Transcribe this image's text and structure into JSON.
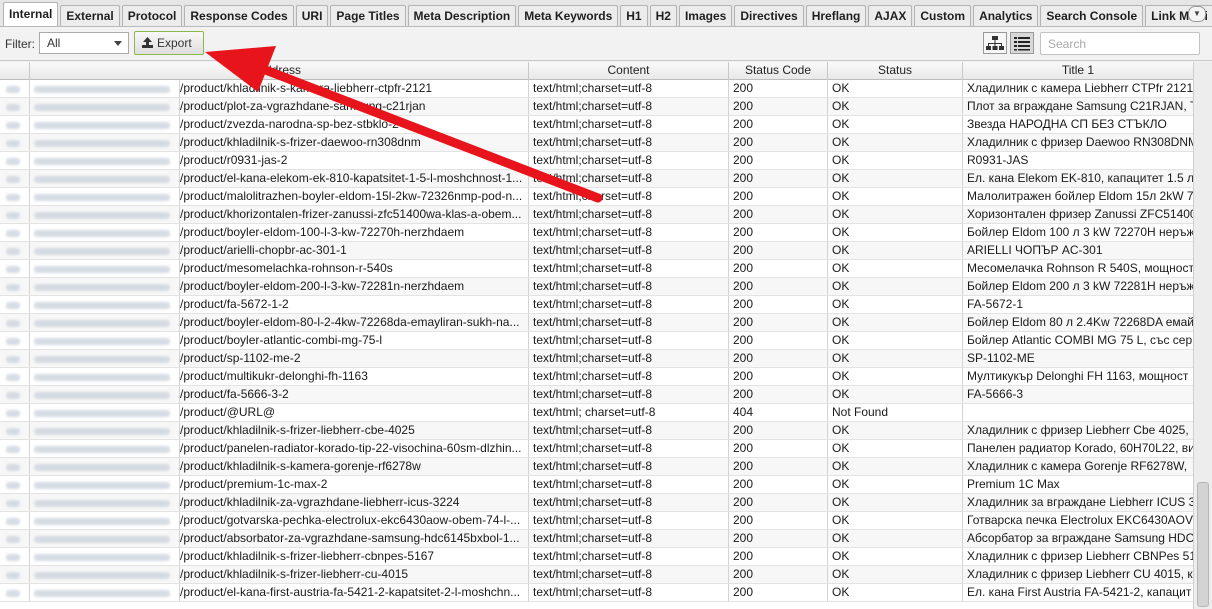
{
  "tabs": [
    {
      "label": "Internal",
      "active": true
    },
    {
      "label": "External"
    },
    {
      "label": "Protocol"
    },
    {
      "label": "Response Codes"
    },
    {
      "label": "URI"
    },
    {
      "label": "Page Titles"
    },
    {
      "label": "Meta Description"
    },
    {
      "label": "Meta Keywords"
    },
    {
      "label": "H1"
    },
    {
      "label": "H2"
    },
    {
      "label": "Images"
    },
    {
      "label": "Directives"
    },
    {
      "label": "Hreflang"
    },
    {
      "label": "AJAX"
    },
    {
      "label": "Custom"
    },
    {
      "label": "Analytics"
    },
    {
      "label": "Search Console"
    },
    {
      "label": "Link Metri"
    }
  ],
  "toolbar": {
    "filter_label": "Filter:",
    "filter_value": "All",
    "export_label": "Export",
    "search_placeholder": "Search"
  },
  "table": {
    "columns": {
      "address": "Address",
      "content": "Content",
      "status_code": "Status Code",
      "status": "Status",
      "title": "Title 1"
    },
    "rows": [
      {
        "address": "/product/khladilnik-s-kamera-liebherr-ctpfr-2121",
        "content": "text/html;charset=utf-8",
        "code": "200",
        "status": "OK",
        "title": "Хладилник с камера Liebherr CTPfr 2121"
      },
      {
        "address": "/product/plot-za-vgrazhdane-samsung-c21rjan",
        "content": "text/html;charset=utf-8",
        "code": "200",
        "status": "OK",
        "title": "Плот за вграждане Samsung C21RJAN, Т"
      },
      {
        "address": "/product/zvezda-narodna-sp-bez-stbklo-2",
        "content": "text/html;charset=utf-8",
        "code": "200",
        "status": "OK",
        "title": "Звезда НАРОДНА СП БЕЗ СТЪКЛО"
      },
      {
        "address": "/product/khladilnik-s-frizer-daewoo-rn308dnm",
        "content": "text/html;charset=utf-8",
        "code": "200",
        "status": "OK",
        "title": "Хладилник с фризер Daewoo RN308DNM"
      },
      {
        "address": "/product/r0931-jas-2",
        "content": "text/html;charset=utf-8",
        "code": "200",
        "status": "OK",
        "title": "R0931-JAS"
      },
      {
        "address": "/product/el-kana-elekom-ek-810-kapatsitet-1-5-l-moshchnost-1...",
        "content": "text/html;charset=utf-8",
        "code": "200",
        "status": "OK",
        "title": "Ел. кана Elekom EK-810, капацитет 1.5 л"
      },
      {
        "address": "/product/malolitrazhen-boyler-eldom-15l-2kw-72326nmp-pod-n...",
        "content": "text/html;charset=utf-8",
        "code": "200",
        "status": "OK",
        "title": "Малолитражен бойлер Eldom 15л 2kW 7"
      },
      {
        "address": "/product/khorizontalen-frizer-zanussi-zfc51400wa-klas-a-obem...",
        "content": "text/html;charset=utf-8",
        "code": "200",
        "status": "OK",
        "title": "Хоризонтален фризер Zanussi ZFC51400"
      },
      {
        "address": "/product/boyler-eldom-100-l-3-kw-72270h-nerzhdaem",
        "content": "text/html;charset=utf-8",
        "code": "200",
        "status": "OK",
        "title": "Бойлер Eldom 100 л 3 kW 72270H неръж"
      },
      {
        "address": "/product/arielli-chopbr-ac-301-1",
        "content": "text/html;charset=utf-8",
        "code": "200",
        "status": "OK",
        "title": "ARIELLI ЧОПЪР AC-301"
      },
      {
        "address": "/product/mesomelachka-rohnson-r-540s",
        "content": "text/html;charset=utf-8",
        "code": "200",
        "status": "OK",
        "title": "Месомелачка Rohnson R 540S, мощност"
      },
      {
        "address": "/product/boyler-eldom-200-l-3-kw-72281n-nerzhdaem",
        "content": "text/html;charset=utf-8",
        "code": "200",
        "status": "OK",
        "title": "Бойлер Eldom 200 л 3 kW 72281H неръж"
      },
      {
        "address": "/product/fa-5672-1-2",
        "content": "text/html;charset=utf-8",
        "code": "200",
        "status": "OK",
        "title": "FA-5672-1"
      },
      {
        "address": "/product/boyler-eldom-80-l-2-4kw-72268da-emayliran-sukh-na...",
        "content": "text/html;charset=utf-8",
        "code": "200",
        "status": "OK",
        "title": "Бойлер Eldom 80 л 2.4Kw 72268DA емай"
      },
      {
        "address": "/product/boyler-atlantic-combi-mg-75-l",
        "content": "text/html;charset=utf-8",
        "code": "200",
        "status": "OK",
        "title": "Бойлер Atlantic COMBI MG 75 L, със сер"
      },
      {
        "address": "/product/sp-1102-me-2",
        "content": "text/html;charset=utf-8",
        "code": "200",
        "status": "OK",
        "title": "SP-1102-ME"
      },
      {
        "address": "/product/multikukr-delonghi-fh-1163",
        "content": "text/html;charset=utf-8",
        "code": "200",
        "status": "OK",
        "title": "Мултикукър Delonghi FH 1163, мощност"
      },
      {
        "address": "/product/fa-5666-3-2",
        "content": "text/html;charset=utf-8",
        "code": "200",
        "status": "OK",
        "title": "FA-5666-3"
      },
      {
        "address": "/product/@URL@",
        "content": "text/html; charset=utf-8",
        "code": "404",
        "status": "Not Found",
        "title": ""
      },
      {
        "address": "/product/khladilnik-s-frizer-liebherr-cbe-4025",
        "content": "text/html;charset=utf-8",
        "code": "200",
        "status": "OK",
        "title": "Хладилник с фризер Liebherr Cbe 4025,"
      },
      {
        "address": "/product/panelen-radiator-korado-tip-22-visochina-60sm-dlzhin...",
        "content": "text/html;charset=utf-8",
        "code": "200",
        "status": "OK",
        "title": "Панелен радиатор Korado, 60H70L22, ви"
      },
      {
        "address": "/product/khladilnik-s-kamera-gorenje-rf6278w",
        "content": "text/html;charset=utf-8",
        "code": "200",
        "status": "OK",
        "title": "Хладилник с камера Gorenje RF6278W, "
      },
      {
        "address": "/product/premium-1c-max-2",
        "content": "text/html;charset=utf-8",
        "code": "200",
        "status": "OK",
        "title": "Premium 1C Max"
      },
      {
        "address": "/product/khladilnik-za-vgrazhdane-liebherr-icus-3224",
        "content": "text/html;charset=utf-8",
        "code": "200",
        "status": "OK",
        "title": "Хладилник за вграждане Liebherr ICUS 3"
      },
      {
        "address": "/product/gotvarska-pechka-electrolux-ekc6430aow-obem-74-l-...",
        "content": "text/html;charset=utf-8",
        "code": "200",
        "status": "OK",
        "title": "Готварска печка Electrolux EKC6430AOV"
      },
      {
        "address": "/product/absorbator-za-vgrazhdane-samsung-hdc6145bxbol-1...",
        "content": "text/html;charset=utf-8",
        "code": "200",
        "status": "OK",
        "title": "Абсорбатор за вграждане Samsung HDC"
      },
      {
        "address": "/product/khladilnik-s-frizer-liebherr-cbnpes-5167",
        "content": "text/html;charset=utf-8",
        "code": "200",
        "status": "OK",
        "title": "Хладилник с фризер Liebherr CBNPes 51"
      },
      {
        "address": "/product/khladilnik-s-frizer-liebherr-cu-4015",
        "content": "text/html;charset=utf-8",
        "code": "200",
        "status": "OK",
        "title": "Хладилник с фризер Liebherr CU 4015, к"
      },
      {
        "address": "/product/el-kana-first-austria-fa-5421-2-kapatsitet-2-l-moshchn...",
        "content": "text/html;charset=utf-8",
        "code": "200",
        "status": "OK",
        "title": "Ел. кана First Austria FA-5421-2, капацит"
      }
    ]
  },
  "colors": {
    "annotation_arrow": "#e8141c",
    "export_border": "#8ab84a"
  },
  "icons": {
    "export": "upload-icon",
    "tree_view": "tree-view-icon",
    "list_view": "list-view-icon",
    "tab_menu": "chevron-down-icon"
  }
}
